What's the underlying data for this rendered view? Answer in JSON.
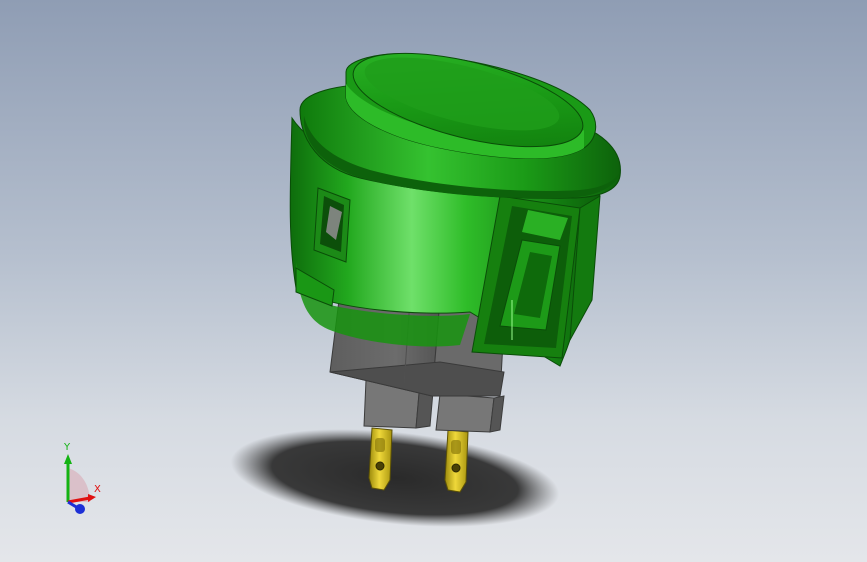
{
  "triad": {
    "x_label": "X",
    "y_label": "Y"
  },
  "colors": {
    "body_green": "#1fa51b",
    "housing_gray": "#6e6e6e",
    "terminal_gold": "#d8c21a",
    "axis_x": "#e01010",
    "axis_y": "#13b313",
    "axis_z": "#1d2fd6"
  },
  "icons": {
    "model": "arcade-pushbutton-3d-model",
    "orientation": "orientation-triad-icon"
  }
}
